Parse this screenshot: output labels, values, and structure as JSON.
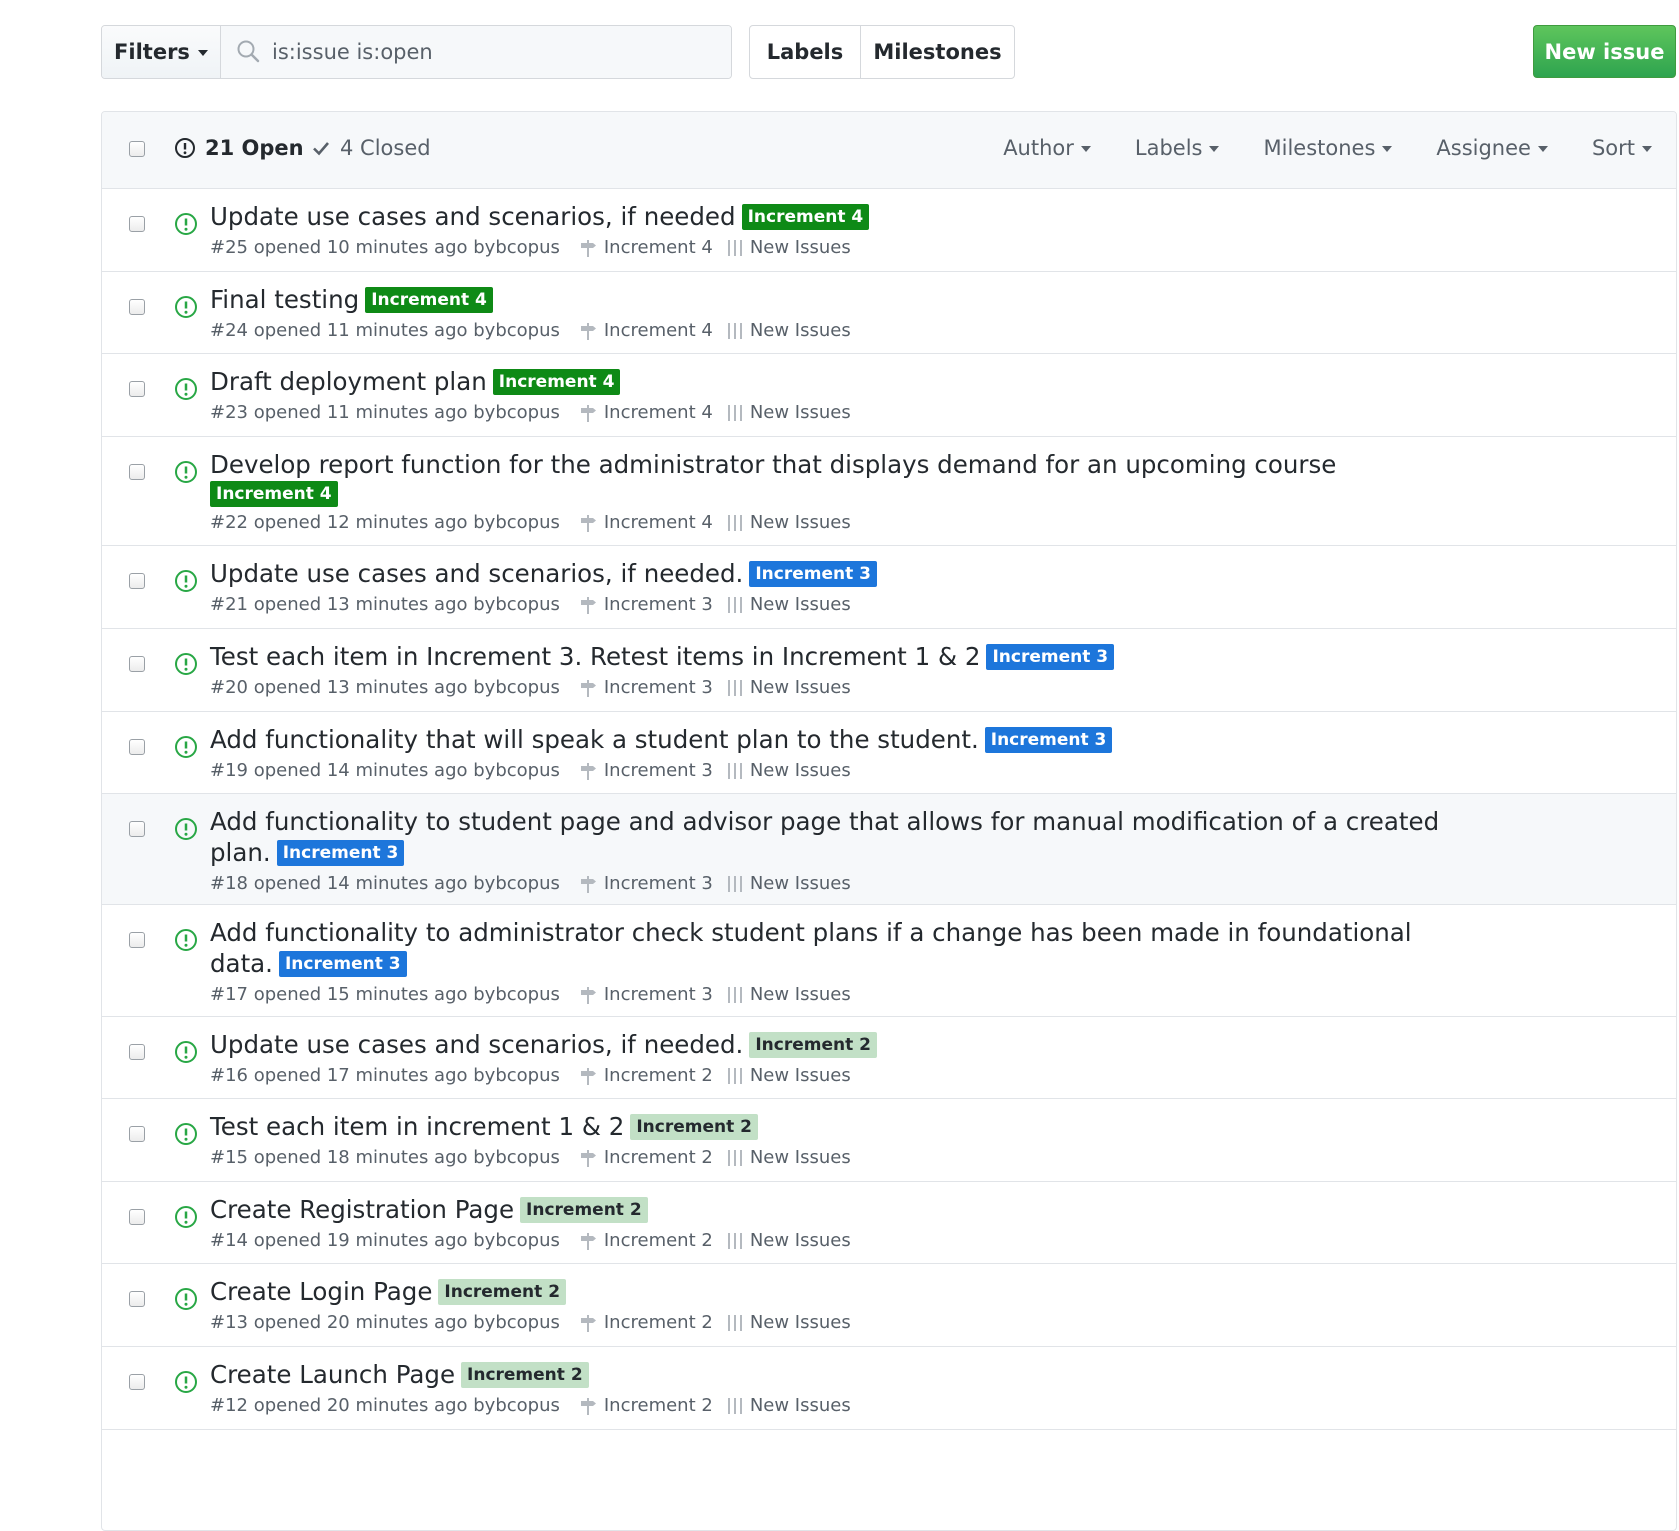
{
  "toolbar": {
    "filters_label": "Filters",
    "search_value": "is:issue is:open",
    "labels_label": "Labels",
    "milestones_label": "Milestones",
    "new_issue_label": "New issue"
  },
  "list_header": {
    "open_label": "21 Open",
    "closed_label": "4 Closed",
    "filters": [
      "Author",
      "Labels",
      "Milestones",
      "Assignee",
      "Sort"
    ]
  },
  "colors": {
    "open_icon": "#28a745",
    "increment_4_bg": "#0e8a16",
    "increment_4_fg": "#ffffff",
    "increment_3_bg": "#1d76db",
    "increment_3_fg": "#ffffff",
    "increment_2_bg": "#c2e0c6",
    "increment_2_fg": "#24292e",
    "new_issue": "#2ea44f"
  },
  "issues": [
    {
      "title": "Update use cases and scenarios, if needed",
      "label": "Increment 4",
      "meta": "#25 opened 10 minutes ago by ",
      "author": "bcopus",
      "milestone": "Increment 4",
      "project": "New Issues"
    },
    {
      "title": "Final testing",
      "label": "Increment 4",
      "meta": "#24 opened 11 minutes ago by ",
      "author": "bcopus",
      "milestone": "Increment 4",
      "project": "New Issues"
    },
    {
      "title": "Draft deployment plan",
      "label": "Increment 4",
      "meta": "#23 opened 11 minutes ago by ",
      "author": "bcopus",
      "milestone": "Increment 4",
      "project": "New Issues"
    },
    {
      "title": "Develop report function for the administrator that displays demand for an upcoming course",
      "label": "Increment 4",
      "meta": "#22 opened 12 minutes ago by ",
      "author": "bcopus",
      "milestone": "Increment 4",
      "project": "New Issues"
    },
    {
      "title": "Update use cases and scenarios, if needed.",
      "label": "Increment 3",
      "meta": "#21 opened 13 minutes ago by ",
      "author": "bcopus",
      "milestone": "Increment 3",
      "project": "New Issues"
    },
    {
      "title": "Test each item in Increment 3. Retest items in Increment 1 & 2",
      "label": "Increment 3",
      "meta": "#20 opened 13 minutes ago by ",
      "author": "bcopus",
      "milestone": "Increment 3",
      "project": "New Issues"
    },
    {
      "title": "Add functionality that will speak a student plan to the student.",
      "label": "Increment 3",
      "meta": "#19 opened 14 minutes ago by ",
      "author": "bcopus",
      "milestone": "Increment 3",
      "project": "New Issues"
    },
    {
      "title": "Add functionality to student page and advisor page that allows for manual modification of a created plan.",
      "label": "Increment 3",
      "meta": "#18 opened 14 minutes ago by ",
      "author": "bcopus",
      "milestone": "Increment 3",
      "project": "New Issues"
    },
    {
      "title": "Add functionality to administrator check student plans if a change has been made in foundational data.",
      "label": "Increment 3",
      "meta": "#17 opened 15 minutes ago by ",
      "author": "bcopus",
      "milestone": "Increment 3",
      "project": "New Issues"
    },
    {
      "title": "Update use cases and scenarios, if needed.",
      "label": "Increment 2",
      "meta": "#16 opened 17 minutes ago by ",
      "author": "bcopus",
      "milestone": "Increment 2",
      "project": "New Issues"
    },
    {
      "title": "Test each item in increment 1 & 2",
      "label": "Increment 2",
      "meta": "#15 opened 18 minutes ago by ",
      "author": "bcopus",
      "milestone": "Increment 2",
      "project": "New Issues"
    },
    {
      "title": "Create Registration Page",
      "label": "Increment 2",
      "meta": "#14 opened 19 minutes ago by ",
      "author": "bcopus",
      "milestone": "Increment 2",
      "project": "New Issues"
    },
    {
      "title": "Create Login Page",
      "label": "Increment 2",
      "meta": "#13 opened 20 minutes ago by ",
      "author": "bcopus",
      "milestone": "Increment 2",
      "project": "New Issues"
    },
    {
      "title": "Create Launch Page",
      "label": "Increment 2",
      "meta": "#12 opened 20 minutes ago by ",
      "author": "bcopus",
      "milestone": "Increment 2",
      "project": "New Issues"
    }
  ]
}
